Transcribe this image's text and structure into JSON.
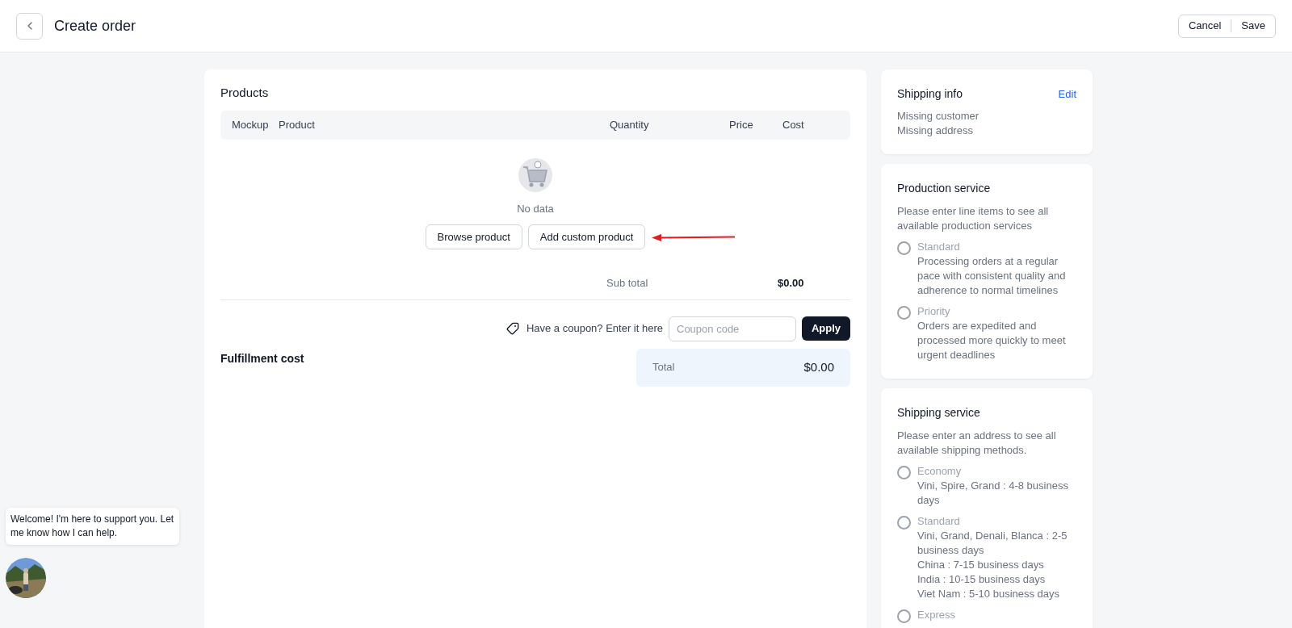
{
  "header": {
    "title": "Create order",
    "buttons": [
      "Cancel",
      "Save"
    ]
  },
  "products": {
    "title": "Products",
    "columns": [
      "Mockup",
      "Product",
      "Quantity",
      "Price",
      "Cost"
    ],
    "empty_text": "No data",
    "buttons": [
      "Browse product",
      "Add custom product"
    ],
    "subtotal_label": "Sub total",
    "subtotal_value": "$0.00",
    "coupon": {
      "label": "Have a coupon? Enter it here",
      "placeholder": "Coupon code",
      "button": "Apply"
    },
    "fulfillment_title": "Fulfillment cost",
    "total_label": "Total",
    "total_value": "$0.00"
  },
  "shipping_info": {
    "title": "Shipping info",
    "action": "Edit",
    "lines": [
      "Missing customer",
      "Missing address"
    ]
  },
  "production_service": {
    "title": "Production service",
    "note": "Please enter line items to see all available production services",
    "options": [
      {
        "label": "Standard",
        "lines": [
          "Processing orders at a regular pace with consistent quality and adherence to normal timelines"
        ],
        "selected": false
      },
      {
        "label": "Priority",
        "lines": [
          "Orders are expedited and processed more quickly to meet urgent deadlines"
        ],
        "selected": false
      }
    ]
  },
  "shipping_service": {
    "title": "Shipping service",
    "note": "Please enter an address to see all available shipping methods.",
    "options": [
      {
        "label": "Economy",
        "lines": [
          "Vini, Spire, Grand : 4-8 business days"
        ],
        "selected": false
      },
      {
        "label": "Standard",
        "lines": [
          "Vini, Grand, Denali, Blanca : 2-5 business days",
          "China : 7-15 business days",
          "India : 10-15 business days",
          "Viet Nam : 5-10 business days"
        ],
        "selected": false
      },
      {
        "label": "Express",
        "selected": false
      }
    ]
  },
  "chat": {
    "message": "Welcome! I'm here to support you. Let me know how I can help."
  }
}
